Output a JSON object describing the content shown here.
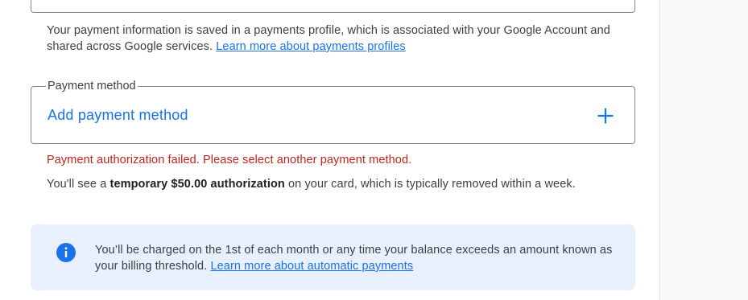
{
  "profile_notice": {
    "text": "Your payment information is saved in a payments profile, which is associated with your Google Account and shared across Google services. ",
    "link": "Learn more about payments profiles"
  },
  "payment_method": {
    "legend": "Payment method",
    "add_label": "Add payment method",
    "add_icon": "plus-icon"
  },
  "error": {
    "message": "Payment authorization failed. Please select another payment method."
  },
  "authorization": {
    "prefix": "You'll see a ",
    "bold": "temporary $50.00 authorization",
    "suffix": " on your card, which is typically removed within a week."
  },
  "info_box": {
    "icon": "info-icon",
    "text": "You’ll be charged on the 1st of each month or any time your balance exceeds an amount known as your billing threshold. ",
    "link": "Learn more about automatic payments"
  },
  "colors": {
    "accent": "#1a73e8",
    "error": "#c5221f",
    "info_bg": "#e8f0fe"
  }
}
